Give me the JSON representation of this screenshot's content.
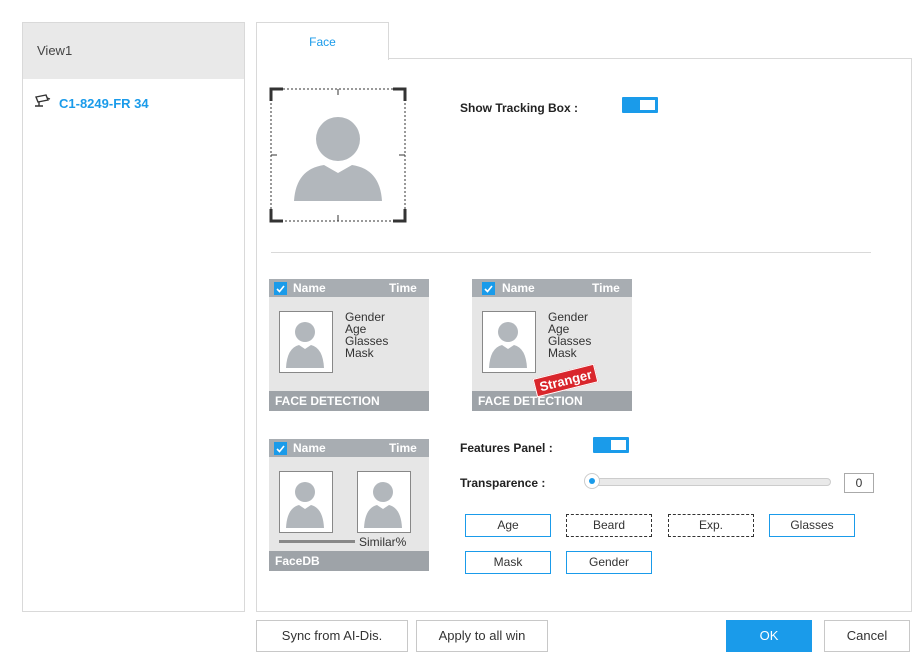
{
  "left_panel": {
    "view_title": "View1",
    "camera_label": "C1-8249-FR 34"
  },
  "tabs": [
    {
      "label": "Face"
    }
  ],
  "face": {
    "show_tracking_label": "Show Tracking Box :",
    "show_tracking_on": true,
    "cards": [
      {
        "name": "Name",
        "time": "Time",
        "attributes": [
          "Gender",
          "Age",
          "Glasses",
          "Mask"
        ],
        "footer": "FACE DETECTION"
      },
      {
        "name": "Name",
        "time": "Time",
        "attributes": [
          "Gender",
          "Age",
          "Glasses",
          "Mask"
        ],
        "footer": "FACE DETECTION",
        "stamp": "Stranger"
      },
      {
        "name": "Name",
        "time": "Time",
        "similar": "Similar%",
        "footer": "FaceDB"
      }
    ],
    "features_panel_label": "Features Panel :",
    "features_panel_on": true,
    "transparence_label": "Transparence :",
    "transparence_value": "0",
    "feature_buttons": [
      {
        "label": "Age",
        "style": "solid"
      },
      {
        "label": "Beard",
        "style": "dashed"
      },
      {
        "label": "Exp.",
        "style": "dashed"
      },
      {
        "label": "Glasses",
        "style": "solid"
      },
      {
        "label": "Mask",
        "style": "solid"
      },
      {
        "label": "Gender",
        "style": "solid"
      }
    ]
  },
  "footer": {
    "sync_label": "Sync from AI-Dis.",
    "apply_label": "Apply to all win",
    "ok_label": "OK",
    "cancel_label": "Cancel"
  },
  "colors": {
    "accent": "#1a9bea",
    "card_header": "#a8adb2",
    "stamp": "#d9262c"
  }
}
